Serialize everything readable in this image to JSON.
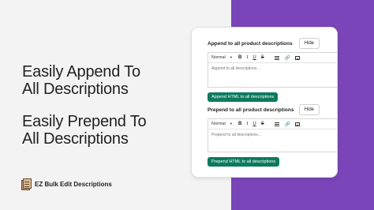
{
  "headlines": {
    "append": [
      "Easily Append To",
      "All Descriptions"
    ],
    "prepend": [
      "Easily Prepend To",
      "All Descriptions"
    ]
  },
  "brand": {
    "name": "EZ Bulk Edit Descriptions"
  },
  "sections": [
    {
      "title": "Append to all product descriptions",
      "hide_label": "Hide",
      "format_label": "Normal",
      "placeholder": "Append to all descriptions...",
      "button_label": "Append HTML to all descriptions"
    },
    {
      "title": "Prepend to all product descriptions",
      "hide_label": "Hide",
      "format_label": "Normal",
      "placeholder": "Prepend to all descriptions...",
      "button_label": "Prepend HTML to all descriptions"
    }
  ],
  "toolbar": {
    "bold": "B",
    "italic": "I",
    "underline": "U",
    "strike": "S",
    "caret": "▾",
    "link": "🔗"
  },
  "colors": {
    "accent_panel": "#7a45b8",
    "button": "#0d7a5f"
  },
  "icons": [
    "bold-icon",
    "italic-icon",
    "underline-icon",
    "strikethrough-icon",
    "align-icon",
    "link-icon",
    "image-icon",
    "brand-logo-icon"
  ]
}
